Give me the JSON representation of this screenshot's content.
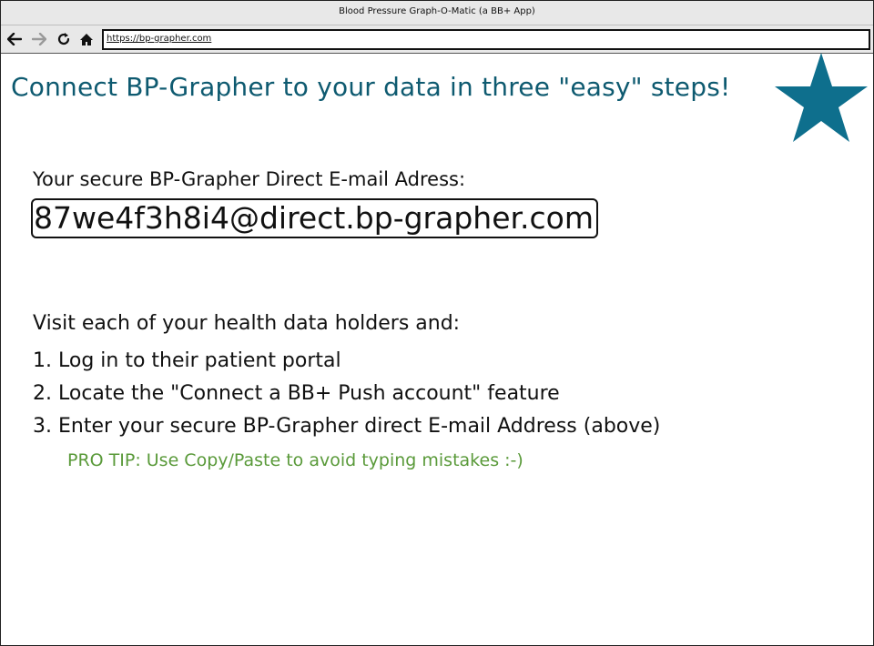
{
  "window": {
    "title": "Blood Pressure Graph-O-Matic (a BB+ App)"
  },
  "toolbar": {
    "back_icon": "back-arrow-icon",
    "forward_icon": "forward-arrow-icon",
    "reload_icon": "reload-icon",
    "home_icon": "home-icon",
    "url": "https://bp-grapher.com"
  },
  "main": {
    "headline": "Connect BP-Grapher to your data in three \"easy\" steps!",
    "star_icon": "star-icon",
    "star_color": "#0e6f8d",
    "email_label": "Your secure BP-Grapher Direct E-mail Adress:",
    "email_address": "87we4f3h8i4@direct.bp-grapher.com",
    "intro": "Visit each of your health data holders and:",
    "steps": [
      "1. Log in to their patient portal",
      "2. Locate the \"Connect a BB+ Push account\" feature",
      "3. Enter your secure BP-Grapher direct E-mail Address (above)"
    ],
    "pro_tip": "PRO TIP: Use Copy/Paste to avoid typing mistakes :-)",
    "pro_tip_color": "#5a9a3a",
    "headline_color": "#0e5a70"
  }
}
